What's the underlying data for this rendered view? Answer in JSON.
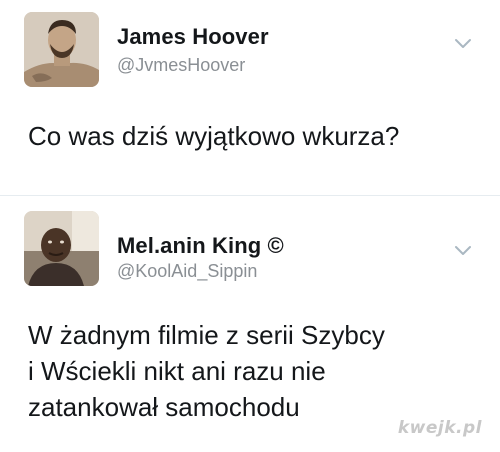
{
  "tweets": [
    {
      "name": "James Hoover",
      "handle": "@JvmesHoover",
      "text_lines": [
        "Co was dziś wyjątkowo wkurza?"
      ],
      "avatar_icon": "profile-photo"
    },
    {
      "name": "Mel.anin King ©",
      "handle": "@KoolAid_Sippin",
      "text_lines": [
        "W żadnym filmie z serii Szybcy",
        "i Wściekli nikt ani razu nie",
        "zatankował samochodu"
      ],
      "avatar_icon": "profile-photo"
    }
  ],
  "icons": {
    "more_options": "chevron-down-icon"
  },
  "colors": {
    "text": "#14171a",
    "handle": "#8a8f94",
    "chevron": "#aab8c2",
    "watermark": "#c8c8c8"
  },
  "watermark": "kwejk.pl"
}
